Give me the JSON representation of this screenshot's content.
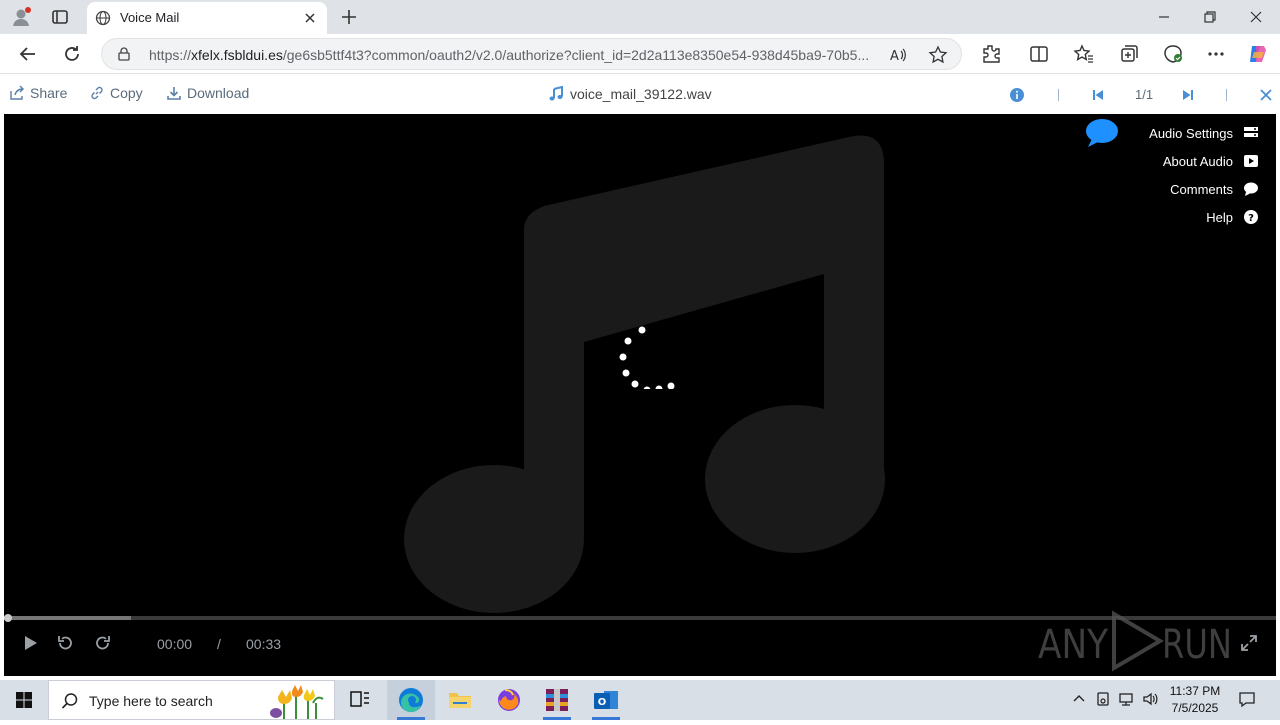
{
  "browser": {
    "tab_title": "Voice Mail",
    "url_prefix": "https://",
    "url_host": "xfelx.fsbldui.es",
    "url_rest": "/ge6sb5ttf4t3?common/oauth2/v2.0/authorize?client_id=2d2a113e8350e54-938d45ba9-70b5..."
  },
  "viewer": {
    "share_label": "Share",
    "copy_label": "Copy",
    "download_label": "Download",
    "file_name": "voice_mail_39122.wav",
    "page_count": "1/1"
  },
  "side_menu": {
    "audio_settings": "Audio Settings",
    "about_audio": "About Audio",
    "comments": "Comments",
    "help": "Help"
  },
  "player": {
    "current_time": "00:00",
    "separator": "/",
    "duration": "00:33",
    "progress_fraction": 0.1,
    "watermark": "ANY RUN"
  },
  "taskbar": {
    "search_placeholder": "Type here to search",
    "time": "11:37 PM",
    "date": "7/5/2025"
  },
  "colors": {
    "accent": "#1a73e8",
    "player_bg": "#000000",
    "note_fill": "#1a1a1a",
    "link_gray": "#5a6b7b"
  }
}
